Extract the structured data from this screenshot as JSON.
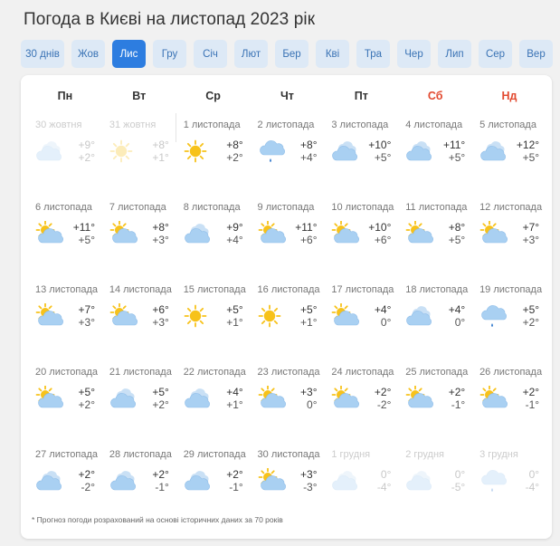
{
  "page_title": "Погода в Києві на листопад 2023 рік",
  "tabs": [
    {
      "label": "30 днів",
      "wide": true,
      "active": false
    },
    {
      "label": "Жов",
      "active": false
    },
    {
      "label": "Лис",
      "active": true
    },
    {
      "label": "Гру",
      "active": false
    },
    {
      "label": "Січ",
      "active": false
    },
    {
      "label": "Лют",
      "active": false
    },
    {
      "label": "Бер",
      "active": false
    },
    {
      "label": "Кві",
      "active": false
    },
    {
      "label": "Тра",
      "active": false
    },
    {
      "label": "Чер",
      "active": false
    },
    {
      "label": "Лип",
      "active": false
    },
    {
      "label": "Сер",
      "active": false
    },
    {
      "label": "Вер",
      "active": false
    }
  ],
  "weekdays": [
    {
      "label": "Пн",
      "weekend": false
    },
    {
      "label": "Вт",
      "weekend": false
    },
    {
      "label": "Ср",
      "weekend": false
    },
    {
      "label": "Чт",
      "weekend": false
    },
    {
      "label": "Пт",
      "weekend": false
    },
    {
      "label": "Сб",
      "weekend": true
    },
    {
      "label": "Нд",
      "weekend": true
    }
  ],
  "colors": {
    "accent": "#2d7de0",
    "weekend": "#e2492f",
    "sun": "#f7c21a",
    "cloud": "#a9d0f2",
    "rain": "#3b7fcf"
  },
  "days": [
    {
      "date": "30 жовтня",
      "hi": "+9°",
      "lo": "+2°",
      "icon": "cloudy-icon",
      "off": true
    },
    {
      "date": "31 жовтня",
      "hi": "+8°",
      "lo": "+1°",
      "icon": "sun-icon",
      "off": true
    },
    {
      "date": "1 листопада",
      "hi": "+8°",
      "lo": "+2°",
      "icon": "sun-icon",
      "off": false
    },
    {
      "date": "2 листопада",
      "hi": "+8°",
      "lo": "+4°",
      "icon": "rain-icon",
      "off": false
    },
    {
      "date": "3 листопада",
      "hi": "+10°",
      "lo": "+5°",
      "icon": "cloudy-icon",
      "off": false
    },
    {
      "date": "4 листопада",
      "hi": "+11°",
      "lo": "+5°",
      "icon": "cloudy-icon",
      "off": false
    },
    {
      "date": "5 листопада",
      "hi": "+12°",
      "lo": "+5°",
      "icon": "cloudy-icon",
      "off": false
    },
    {
      "date": "6 листопада",
      "hi": "+11°",
      "lo": "+5°",
      "icon": "partly-cloudy-icon",
      "off": false
    },
    {
      "date": "7 листопада",
      "hi": "+8°",
      "lo": "+3°",
      "icon": "partly-cloudy-icon",
      "off": false
    },
    {
      "date": "8 листопада",
      "hi": "+9°",
      "lo": "+4°",
      "icon": "cloudy-icon",
      "off": false
    },
    {
      "date": "9 листопада",
      "hi": "+11°",
      "lo": "+6°",
      "icon": "partly-cloudy-icon",
      "off": false
    },
    {
      "date": "10 листопада",
      "hi": "+10°",
      "lo": "+6°",
      "icon": "partly-cloudy-icon",
      "off": false
    },
    {
      "date": "11 листопада",
      "hi": "+8°",
      "lo": "+5°",
      "icon": "partly-cloudy-icon",
      "off": false
    },
    {
      "date": "12 листопада",
      "hi": "+7°",
      "lo": "+3°",
      "icon": "partly-cloudy-icon",
      "off": false
    },
    {
      "date": "13 листопада",
      "hi": "+7°",
      "lo": "+3°",
      "icon": "partly-cloudy-icon",
      "off": false
    },
    {
      "date": "14 листопада",
      "hi": "+6°",
      "lo": "+3°",
      "icon": "partly-cloudy-icon",
      "off": false
    },
    {
      "date": "15 листопада",
      "hi": "+5°",
      "lo": "+1°",
      "icon": "sun-icon",
      "off": false
    },
    {
      "date": "16 листопада",
      "hi": "+5°",
      "lo": "+1°",
      "icon": "sun-icon",
      "off": false
    },
    {
      "date": "17 листопада",
      "hi": "+4°",
      "lo": "0°",
      "icon": "partly-cloudy-icon",
      "off": false
    },
    {
      "date": "18 листопада",
      "hi": "+4°",
      "lo": "0°",
      "icon": "cloudy-icon",
      "off": false
    },
    {
      "date": "19 листопада",
      "hi": "+5°",
      "lo": "+2°",
      "icon": "rain-icon",
      "off": false
    },
    {
      "date": "20 листопада",
      "hi": "+5°",
      "lo": "+2°",
      "icon": "partly-cloudy-icon",
      "off": false
    },
    {
      "date": "21 листопада",
      "hi": "+5°",
      "lo": "+2°",
      "icon": "cloudy-icon",
      "off": false
    },
    {
      "date": "22 листопада",
      "hi": "+4°",
      "lo": "+1°",
      "icon": "cloudy-icon",
      "off": false
    },
    {
      "date": "23 листопада",
      "hi": "+3°",
      "lo": "0°",
      "icon": "partly-cloudy-icon",
      "off": false
    },
    {
      "date": "24 листопада",
      "hi": "+2°",
      "lo": "-2°",
      "icon": "partly-cloudy-icon",
      "off": false
    },
    {
      "date": "25 листопада",
      "hi": "+2°",
      "lo": "-1°",
      "icon": "partly-cloudy-icon",
      "off": false
    },
    {
      "date": "26 листопада",
      "hi": "+2°",
      "lo": "-1°",
      "icon": "partly-cloudy-icon",
      "off": false
    },
    {
      "date": "27 листопада",
      "hi": "+2°",
      "lo": "-2°",
      "icon": "cloudy-icon",
      "off": false
    },
    {
      "date": "28 листопада",
      "hi": "+2°",
      "lo": "-1°",
      "icon": "cloudy-icon",
      "off": false
    },
    {
      "date": "29 листопада",
      "hi": "+2°",
      "lo": "-1°",
      "icon": "cloudy-icon",
      "off": false
    },
    {
      "date": "30 листопада",
      "hi": "+3°",
      "lo": "-3°",
      "icon": "partly-cloudy-icon",
      "off": false
    },
    {
      "date": "1 грудня",
      "hi": "0°",
      "lo": "-4°",
      "icon": "cloudy-icon",
      "off": true
    },
    {
      "date": "2 грудня",
      "hi": "0°",
      "lo": "-5°",
      "icon": "cloudy-icon",
      "off": true
    },
    {
      "date": "3 грудня",
      "hi": "0°",
      "lo": "-4°",
      "icon": "rain-icon",
      "off": true
    }
  ],
  "footnote": "* Прогноз погоди розрахований на основі історичних даних за 70 років"
}
